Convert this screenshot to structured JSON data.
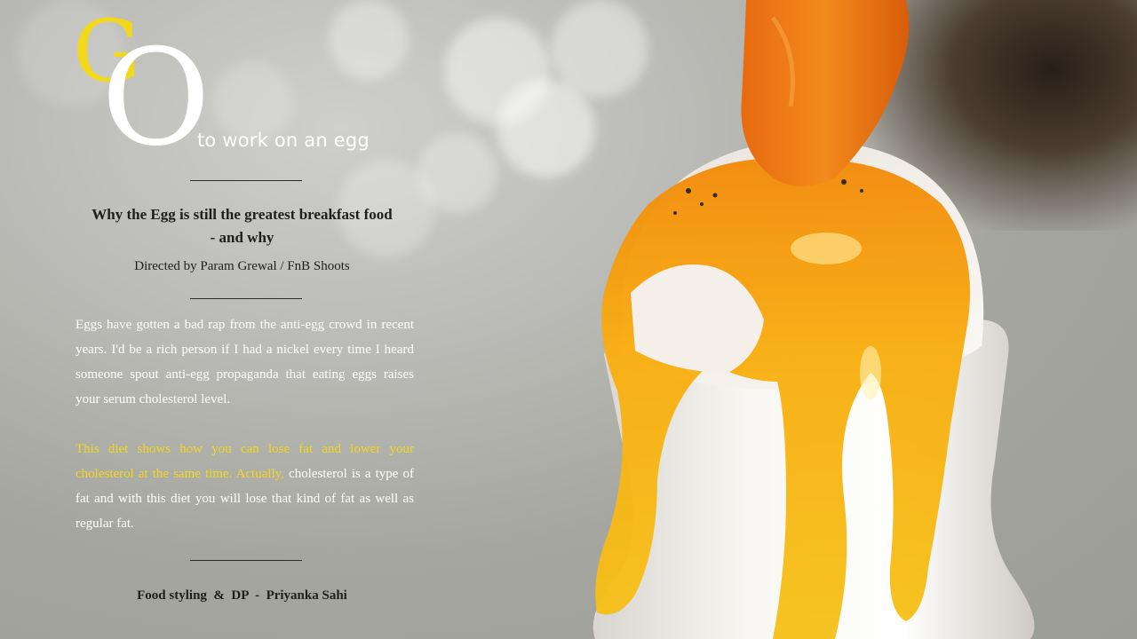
{
  "logo": {
    "letter_g": "G",
    "letter_o": "O",
    "tagline": "to work on an egg",
    "colors": {
      "g": "#f2d81a",
      "o": "#ffffff"
    }
  },
  "article": {
    "headline_line1": "Why the Egg is still the greatest breakfast food",
    "headline_line2": "- and why",
    "credit": "Directed by Param Grewal / FnB Shoots",
    "paragraph1": "Eggs have gotten a bad rap from the anti-egg crowd in recent years. I'd be a rich person if I had a nickel every time I heard someone spout anti-egg propaganda that eating eggs raises your serum cholesterol level.",
    "paragraph2_highlight": "This diet shows how you can lose fat and lower your cholesterol at the same time. Actually,",
    "paragraph2_rest": " cholesterol is a type of fat and with this diet you will lose that kind of fat as well as regular fat.",
    "footer_credit": "Food styling  &  DP  -  Priyanka Sahi"
  },
  "colors": {
    "accent_yellow": "#f4d71e",
    "yolk": "#f6a50f",
    "text_dark": "#1e1e1e",
    "text_light": "#ffffff"
  },
  "image": {
    "subject": "soft-boiled egg in white egg cup with yolk dripping down"
  }
}
